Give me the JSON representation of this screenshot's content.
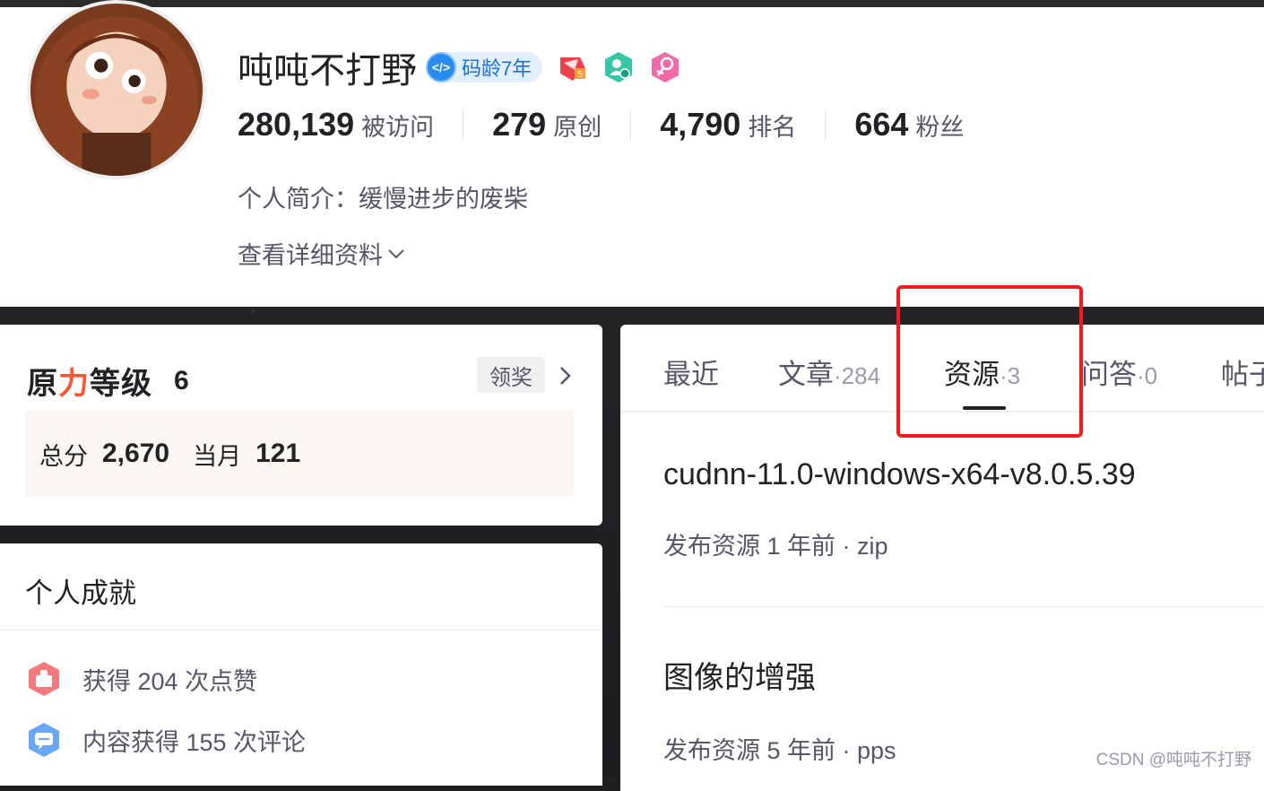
{
  "profile": {
    "username": "吨吨不打野",
    "code_age_badge": "码龄7年",
    "stats": [
      {
        "value": "280,139",
        "label": "被访问"
      },
      {
        "value": "279",
        "label": "原创"
      },
      {
        "value": "4,790",
        "label": "排名"
      },
      {
        "value": "664",
        "label": "粉丝"
      }
    ],
    "bio": "个人简介：缓慢进步的废柴",
    "more_info": "查看详细资料"
  },
  "level_card": {
    "title_part1": "原",
    "title_slash": "力",
    "title_part2": "等级",
    "level": "6",
    "claim_button": "领奖",
    "total_label": "总分",
    "total_value": "2,670",
    "month_label": "当月",
    "month_value": "121"
  },
  "achievements": {
    "title": "个人成就",
    "items": [
      {
        "text": "获得 204 次点赞",
        "icon": "thumbs-up-icon"
      },
      {
        "text": "内容获得 155 次评论",
        "icon": "comment-icon"
      }
    ]
  },
  "tabs": [
    {
      "label": "最近",
      "count": ""
    },
    {
      "label": "文章",
      "count": "·284"
    },
    {
      "label": "资源",
      "count": "·3"
    },
    {
      "label": "问答",
      "count": "·0"
    },
    {
      "label": "帖子",
      "count": ""
    }
  ],
  "active_tab": "资源",
  "resources": [
    {
      "title": "cudnn-11.0-windows-x64-v8.0.5.39",
      "meta": "发布资源 1 年前 ·  zip"
    },
    {
      "title": "图像的增强",
      "meta": "发布资源 5 年前 ·  pps"
    }
  ],
  "watermark": "CSDN @吨吨不打野",
  "colors": {
    "accent_red": "#fc5531",
    "highlight_box": "#ee1c1c",
    "badge_blue": "#2b8cf0",
    "text_primary": "#222226",
    "text_secondary": "#555666"
  }
}
